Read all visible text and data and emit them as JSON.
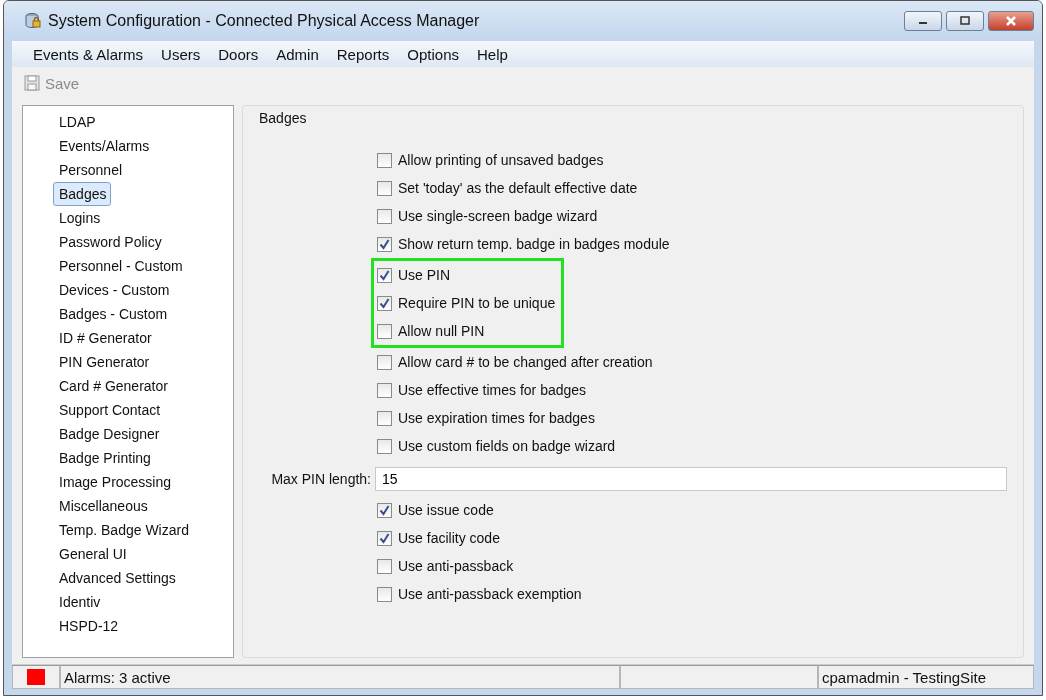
{
  "window": {
    "title": "System Configuration - Connected Physical Access Manager"
  },
  "menu": [
    "Events & Alarms",
    "Users",
    "Doors",
    "Admin",
    "Reports",
    "Options",
    "Help"
  ],
  "toolbar": {
    "save": {
      "label": "Save",
      "disabled": true
    }
  },
  "sidebar": {
    "items": [
      {
        "label": "LDAP",
        "selected": false
      },
      {
        "label": "Events/Alarms",
        "selected": false
      },
      {
        "label": "Personnel",
        "selected": false
      },
      {
        "label": "Badges",
        "selected": true
      },
      {
        "label": "Logins",
        "selected": false
      },
      {
        "label": "Password Policy",
        "selected": false
      },
      {
        "label": "Personnel - Custom",
        "selected": false
      },
      {
        "label": "Devices - Custom",
        "selected": false
      },
      {
        "label": "Badges - Custom",
        "selected": false
      },
      {
        "label": "ID # Generator",
        "selected": false
      },
      {
        "label": "PIN Generator",
        "selected": false
      },
      {
        "label": "Card # Generator",
        "selected": false
      },
      {
        "label": "Support Contact",
        "selected": false
      },
      {
        "label": "Badge Designer",
        "selected": false
      },
      {
        "label": "Badge Printing",
        "selected": false
      },
      {
        "label": "Image Processing",
        "selected": false
      },
      {
        "label": "Miscellaneous",
        "selected": false
      },
      {
        "label": "Temp. Badge Wizard",
        "selected": false
      },
      {
        "label": "General UI",
        "selected": false
      },
      {
        "label": "Advanced Settings",
        "selected": false
      },
      {
        "label": "Identiv",
        "selected": false
      },
      {
        "label": "HSPD-12",
        "selected": false
      }
    ]
  },
  "panel": {
    "title": "Badges",
    "sections": [
      {
        "kind": "checkboxes",
        "highlighted": false,
        "items": [
          {
            "label": "Allow printing of unsaved badges",
            "checked": false
          },
          {
            "label": "Set 'today' as the default effective date",
            "checked": false
          },
          {
            "label": "Use single-screen badge wizard",
            "checked": false
          },
          {
            "label": "Show return temp. badge in badges module",
            "checked": true
          }
        ]
      },
      {
        "kind": "checkboxes",
        "highlighted": true,
        "items": [
          {
            "label": "Use PIN",
            "checked": true
          },
          {
            "label": "Require PIN to be unique",
            "checked": true
          },
          {
            "label": "Allow null PIN",
            "checked": false
          }
        ]
      },
      {
        "kind": "checkboxes",
        "highlighted": false,
        "items": [
          {
            "label": "Allow card # to be changed after creation",
            "checked": false
          },
          {
            "label": "Use effective times for badges",
            "checked": false
          },
          {
            "label": "Use expiration times for badges",
            "checked": false
          },
          {
            "label": "Use custom fields on badge wizard",
            "checked": false
          }
        ]
      },
      {
        "kind": "field",
        "label": "Max PIN length:",
        "value": "15"
      },
      {
        "kind": "checkboxes",
        "highlighted": false,
        "items": [
          {
            "label": "Use issue code",
            "checked": true
          },
          {
            "label": "Use facility code",
            "checked": true
          },
          {
            "label": "Use anti-passback",
            "checked": false
          },
          {
            "label": "Use anti-passback exemption",
            "checked": false
          }
        ]
      }
    ]
  },
  "status_bar": {
    "alarms": "Alarms: 3 active",
    "user": "cpamadmin - TestingSite"
  }
}
